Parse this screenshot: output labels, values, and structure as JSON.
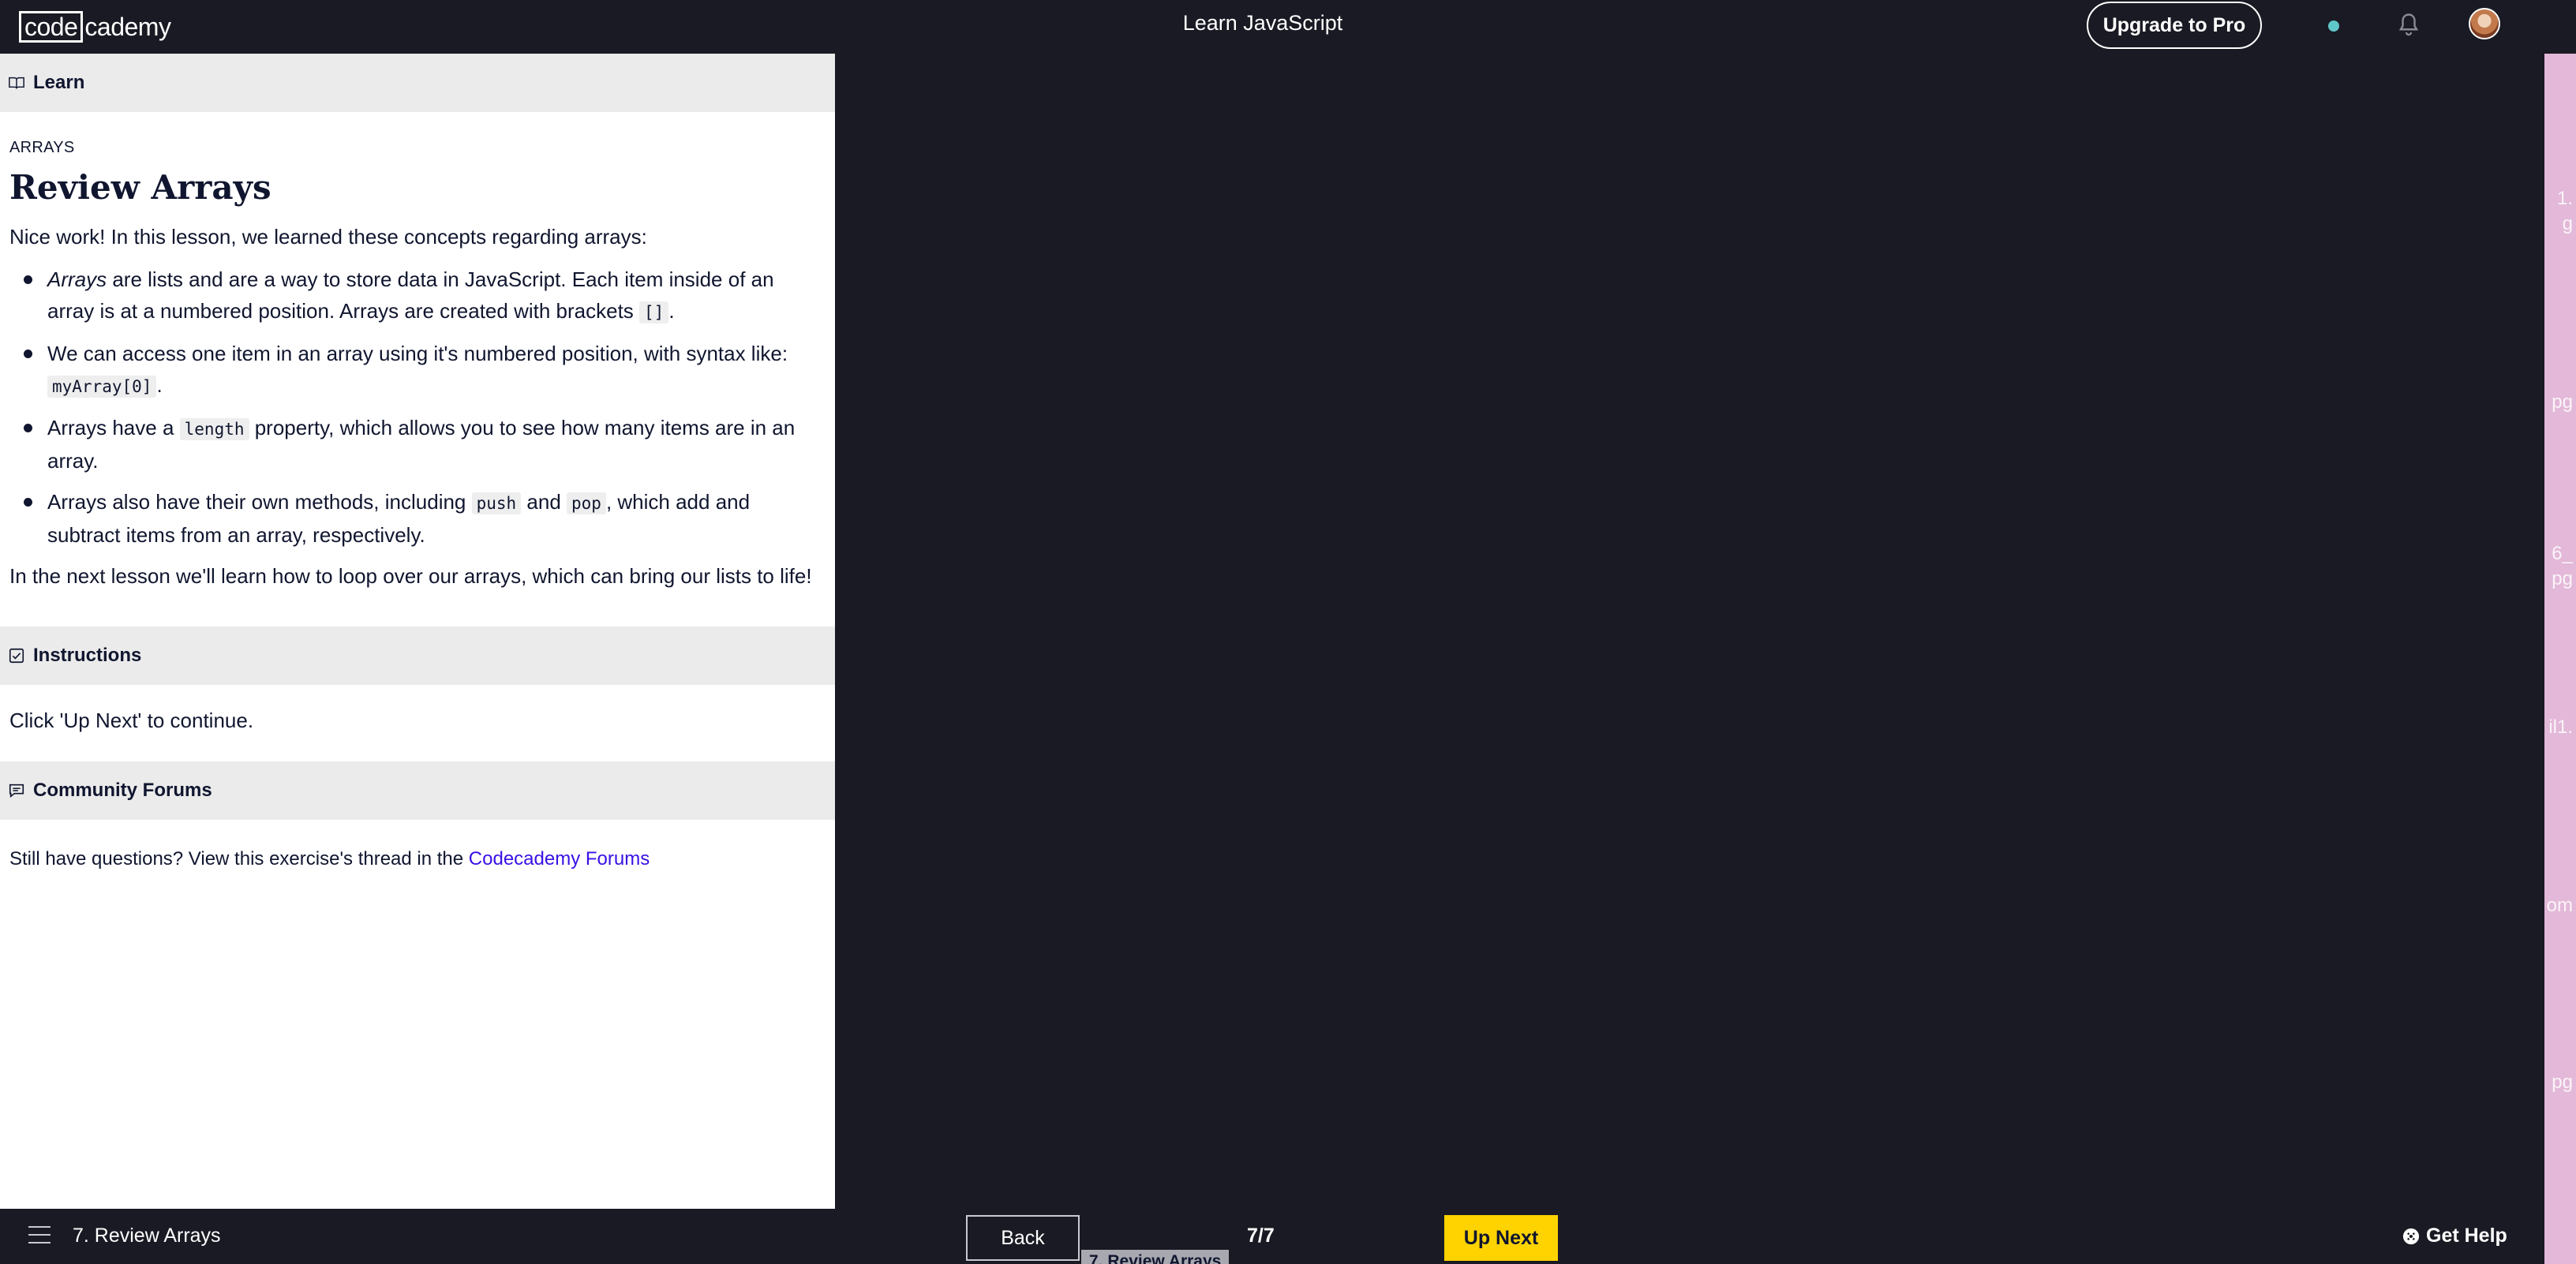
{
  "header": {
    "logo_boxed": "code",
    "logo_rest": "cademy",
    "course_title": "Learn JavaScript",
    "upgrade_label": "Upgrade to Pro"
  },
  "learn": {
    "section_label": "Learn",
    "eyebrow": "ARRAYS",
    "title": "Review Arrays",
    "intro": "Nice work! In this lesson, we learned these concepts regarding arrays:",
    "points": [
      {
        "em": "Arrays",
        "text_a": " are lists and are a way to store data in JavaScript. Each item inside of an array is at a numbered position. Arrays are created with brackets ",
        "code": "[]",
        "text_b": "."
      },
      {
        "text_a": "We can access one item in an array using it's numbered position, with syntax like: ",
        "code": "myArray[0]",
        "text_b": "."
      },
      {
        "text_a": "Arrays have a ",
        "code": "length",
        "text_b": " property, which allows you to see how many items are in an array."
      },
      {
        "text_a": "Arrays also have their own methods, including ",
        "code": "push",
        "text_mid": " and ",
        "code2": "pop",
        "text_b": ", which add and subtract items from an array, respectively."
      }
    ],
    "outro": "In the next lesson we'll learn how to loop over our arrays, which can bring our lists to life!"
  },
  "instructions": {
    "section_label": "Instructions",
    "text": "Click 'Up Next' to continue."
  },
  "forums": {
    "section_label": "Community Forums",
    "text": "Still have questions? View this exercise's thread in the ",
    "link_label": "Codecademy Forums"
  },
  "side_strip": {
    "fragments": [
      "1.",
      "g",
      "pg",
      "6_",
      "pg",
      "il1.",
      "om",
      "pg"
    ]
  },
  "footer": {
    "lesson_label": "7. Review Arrays",
    "back_label": "Back",
    "page_count": "7/7",
    "tooltip": "7. Review Arrays",
    "upnext_label": "Up Next",
    "help_label": "Get Help"
  },
  "colors": {
    "accent_yellow": "#ffd300",
    "dark_bg": "#1a1a24",
    "link": "#3a10e5"
  }
}
